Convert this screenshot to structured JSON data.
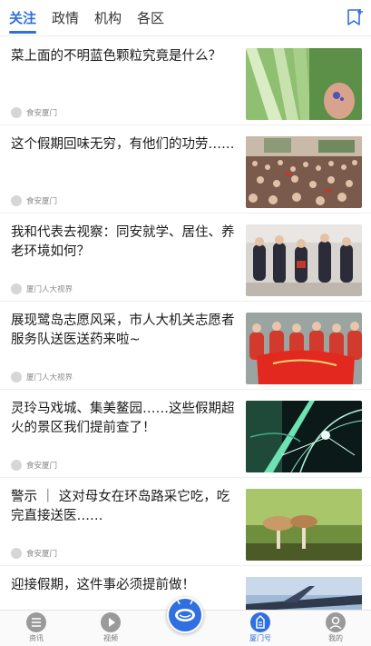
{
  "tabs": [
    {
      "label": "关注",
      "active": true
    },
    {
      "label": "政情",
      "active": false
    },
    {
      "label": "机构",
      "active": false
    },
    {
      "label": "各区",
      "active": false
    }
  ],
  "feed": [
    {
      "title": "菜上面的不明蓝色颗粒究竟是什么？",
      "source": "食安厦门",
      "image": "vegetables"
    },
    {
      "title": "这个假期回味无穷，有他们的功劳……",
      "source": "食安厦门",
      "image": "crowd"
    },
    {
      "title": "我和代表去视察：同安就学、居住、养老环境如何？",
      "source": "厦门人大视界",
      "image": "inspection"
    },
    {
      "title": "展现鹭岛志愿风采，市人大机关志愿者服务队送医送药来啦~",
      "source": "厦门人大视界",
      "image": "volunteers"
    },
    {
      "title": "灵玲马戏城、集美鳌园……这些假期超火的景区我们提前查了！",
      "source": "食安厦门",
      "image": "show"
    },
    {
      "title": "警示 ｜ 这对母女在环岛路采它吃，吃完直接送医……",
      "source": "食安厦门",
      "image": "mushroom"
    },
    {
      "title": "迎接假期，这件事必须提前做！",
      "source": "",
      "image": "plane"
    }
  ],
  "bottom_nav": [
    {
      "label": "资讯",
      "icon": "news-icon",
      "active": false
    },
    {
      "label": "视频",
      "icon": "video-play-icon",
      "active": false
    },
    {
      "label": "",
      "icon": "robot-assistant-icon",
      "active": false
    },
    {
      "label": "厦门号",
      "icon": "xiamen-account-icon",
      "active": true
    },
    {
      "label": "我的",
      "icon": "profile-icon",
      "active": false
    }
  ],
  "colors": {
    "accent": "#2f6fe0",
    "text": "#1a1a1a",
    "muted": "#8a8a8a"
  }
}
